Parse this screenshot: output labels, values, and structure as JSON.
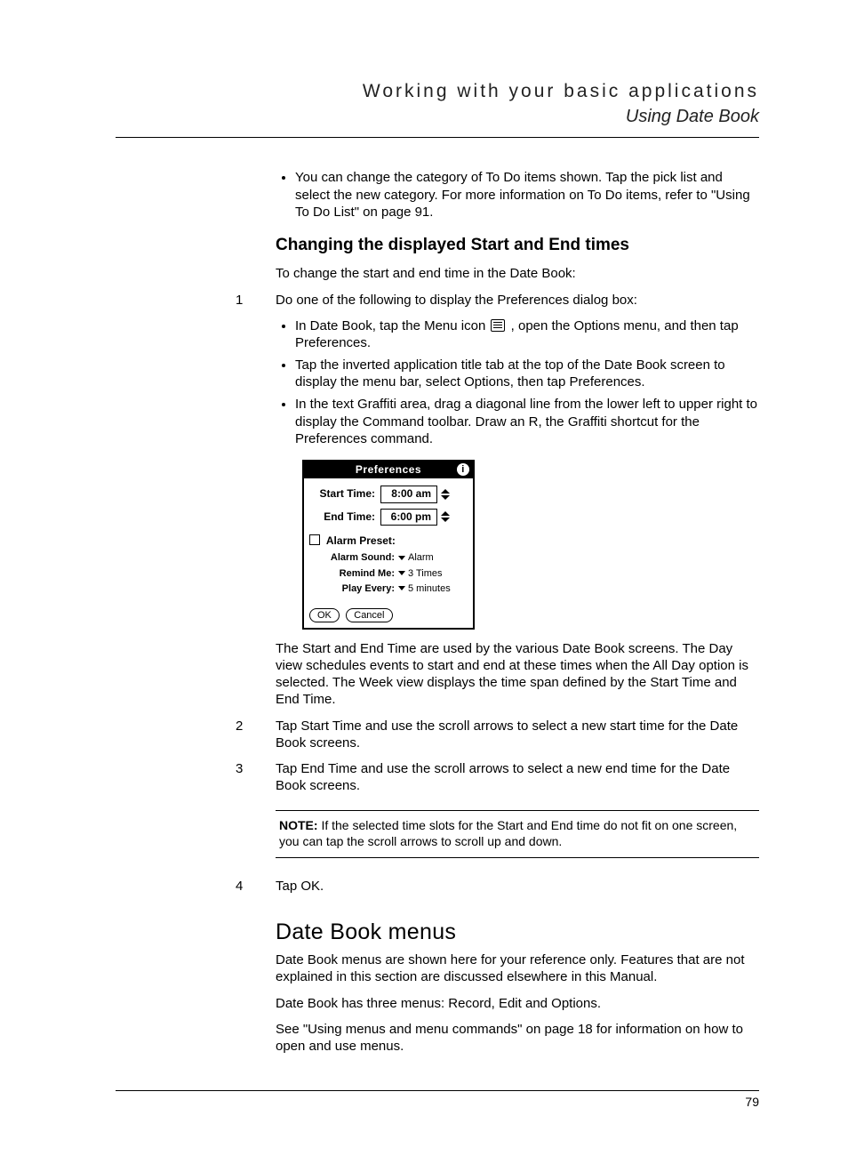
{
  "header": {
    "line1": "Working with your basic applications",
    "line2": "Using Date Book"
  },
  "intro_bullet": "You can change the category of To Do items shown. Tap the pick list and select the new category. For more information on To Do items, refer to \"Using To Do List\" on page 91.",
  "section1": {
    "heading": "Changing the displayed Start and End times",
    "lead": "To change the start and end time in the Date Book:",
    "steps": {
      "s1_num": "1",
      "s1_text": "Do one of the following to display the Preferences dialog box:",
      "s1_bullets": {
        "b1a": "In Date Book, tap the Menu icon ",
        "b1b": ", open the Options menu, and then tap Preferences.",
        "b2": "Tap the inverted application title tab at the top of the Date Book screen to display the menu bar, select Options, then tap Preferences.",
        "b3": "In the text Graffiti area, drag a diagonal line from the lower left to upper right to display the Command toolbar. Draw an R, the Graffiti shortcut for the Preferences command."
      },
      "after_dialog": "The Start and End Time are used by the various Date Book screens. The Day view schedules events to start and end at these times when the All Day option is selected. The Week view displays the time span defined by the Start Time and End Time.",
      "s2_num": "2",
      "s2_text": "Tap Start Time and use the scroll arrows to select a new start time for the Date Book screens.",
      "s3_num": "3",
      "s3_text": "Tap End Time and use the scroll arrows to select a new end time for the Date Book screens.",
      "note_label": "NOTE:",
      "note_text": " If the selected time slots for the Start and End time do not fit on one screen, you can tap the scroll arrows to scroll up and down.",
      "s4_num": "4",
      "s4_text": "Tap OK."
    }
  },
  "dialog": {
    "title": "Preferences",
    "info_glyph": "i",
    "start_label": "Start Time:",
    "start_value": "8:00 am",
    "end_label": "End Time:",
    "end_value": "6:00 pm",
    "alarm_preset": "Alarm Preset:",
    "alarm_sound_label": "Alarm Sound:",
    "alarm_sound_value": "Alarm",
    "remind_label": "Remind Me:",
    "remind_value": "3 Times",
    "play_label": "Play Every:",
    "play_value": "5 minutes",
    "ok": "OK",
    "cancel": "Cancel"
  },
  "section2": {
    "heading": "Date Book menus",
    "p1": "Date Book menus are shown here for your reference only. Features that are not explained in this section are discussed elsewhere in this Manual.",
    "p2": "Date Book has three menus: Record, Edit and Options.",
    "p3": "See \"Using menus and menu commands\" on page 18 for information on how to open and use menus."
  },
  "page_number": "79"
}
